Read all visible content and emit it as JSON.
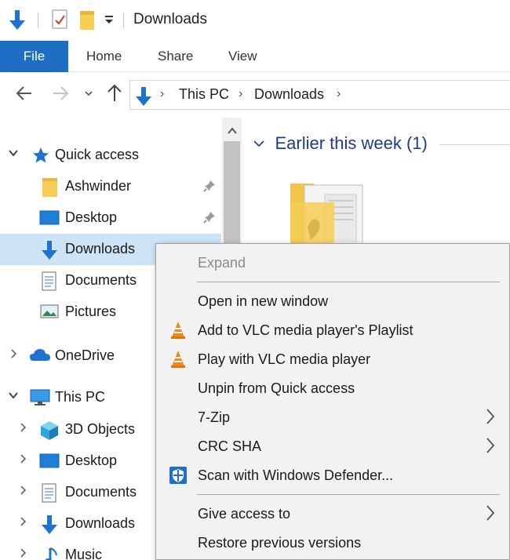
{
  "window": {
    "title": "Downloads"
  },
  "ribbon": {
    "tabs": [
      {
        "label": "File",
        "active": true
      },
      {
        "label": "Home"
      },
      {
        "label": "Share"
      },
      {
        "label": "View"
      }
    ],
    "file_tab_color": "#1e6fc3"
  },
  "address_bar": {
    "crumbs": [
      "This PC",
      "Downloads"
    ]
  },
  "nav_pane": {
    "items": [
      {
        "label": "Quick access",
        "icon": "star-icon",
        "expander": "expanded"
      },
      {
        "label": "Ashwinder",
        "icon": "folder-icon",
        "pinned": true
      },
      {
        "label": "Desktop",
        "icon": "desktop-icon",
        "pinned": true
      },
      {
        "label": "Downloads",
        "icon": "download-icon",
        "selected": true
      },
      {
        "label": "Documents",
        "icon": "document-icon"
      },
      {
        "label": "Pictures",
        "icon": "pictures-icon"
      },
      {
        "label": "OneDrive",
        "icon": "cloud-icon",
        "expander": "collapsed"
      },
      {
        "label": "This PC",
        "icon": "computer-icon",
        "expander": "expanded"
      },
      {
        "label": "3D Objects",
        "icon": "cube-icon",
        "expander": "collapsed"
      },
      {
        "label": "Desktop",
        "icon": "desktop-icon",
        "expander": "collapsed"
      },
      {
        "label": "Documents",
        "icon": "document-icon",
        "expander": "collapsed"
      },
      {
        "label": "Downloads",
        "icon": "download-icon",
        "expander": "collapsed"
      },
      {
        "label": "Music",
        "icon": "music-icon",
        "expander": "collapsed"
      }
    ],
    "selected_color": "#cde4f7"
  },
  "content": {
    "group_header": "Earlier this week (1)",
    "group_color": "#1f3c88"
  },
  "context_menu": {
    "items": [
      {
        "label": "Expand",
        "disabled": true
      },
      {
        "label": "Open in new window"
      },
      {
        "label": "Add to VLC media player's Playlist",
        "icon": "vlc-icon"
      },
      {
        "label": "Play with VLC media player",
        "icon": "vlc-icon"
      },
      {
        "label": "Unpin from Quick access"
      },
      {
        "label": "7-Zip",
        "submenu": true
      },
      {
        "label": "CRC SHA",
        "submenu": true
      },
      {
        "label": "Scan with Windows Defender...",
        "icon": "windows-defender-icon"
      },
      {
        "label": "Give access to",
        "submenu": true
      },
      {
        "label": "Restore previous versions"
      }
    ]
  }
}
